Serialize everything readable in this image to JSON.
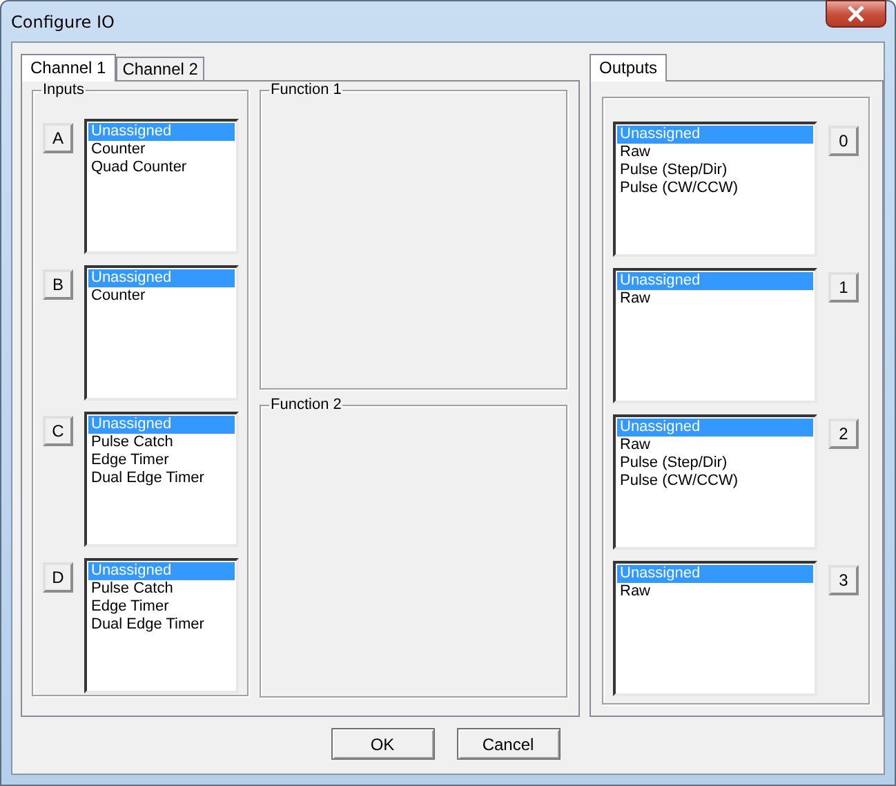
{
  "window": {
    "title": "Configure IO"
  },
  "channel_tabs": [
    {
      "label": "Channel 1",
      "selected": true
    },
    {
      "label": "Channel 2",
      "selected": false
    }
  ],
  "inputs": {
    "label": "Inputs",
    "rows": [
      {
        "button": "A",
        "items": [
          {
            "label": "Unassigned",
            "selected": true
          },
          {
            "label": "Counter",
            "selected": false
          },
          {
            "label": "Quad Counter",
            "selected": false
          }
        ]
      },
      {
        "button": "B",
        "items": [
          {
            "label": "Unassigned",
            "selected": true
          },
          {
            "label": "Counter",
            "selected": false
          }
        ]
      },
      {
        "button": "C",
        "items": [
          {
            "label": "Unassigned",
            "selected": true
          },
          {
            "label": "Pulse Catch",
            "selected": false
          },
          {
            "label": "Edge Timer",
            "selected": false
          },
          {
            "label": "Dual Edge Timer",
            "selected": false
          }
        ]
      },
      {
        "button": "D",
        "items": [
          {
            "label": "Unassigned",
            "selected": true
          },
          {
            "label": "Pulse Catch",
            "selected": false
          },
          {
            "label": "Edge Timer",
            "selected": false
          },
          {
            "label": "Dual Edge Timer",
            "selected": false
          }
        ]
      }
    ]
  },
  "functions": [
    {
      "label": "Function 1"
    },
    {
      "label": "Function 2"
    }
  ],
  "output_tabs": [
    {
      "label": "Outputs",
      "selected": true
    }
  ],
  "outputs": {
    "rows": [
      {
        "button": "0",
        "items": [
          {
            "label": "Unassigned",
            "selected": true
          },
          {
            "label": "Raw",
            "selected": false
          },
          {
            "label": "Pulse (Step/Dir)",
            "selected": false
          },
          {
            "label": "Pulse (CW/CCW)",
            "selected": false
          }
        ]
      },
      {
        "button": "1",
        "items": [
          {
            "label": "Unassigned",
            "selected": true
          },
          {
            "label": "Raw",
            "selected": false
          }
        ]
      },
      {
        "button": "2",
        "items": [
          {
            "label": "Unassigned",
            "selected": true
          },
          {
            "label": "Raw",
            "selected": false
          },
          {
            "label": "Pulse (Step/Dir)",
            "selected": false
          },
          {
            "label": "Pulse (CW/CCW)",
            "selected": false
          }
        ]
      },
      {
        "button": "3",
        "items": [
          {
            "label": "Unassigned",
            "selected": true
          },
          {
            "label": "Raw",
            "selected": false
          }
        ]
      }
    ]
  },
  "buttons": [
    {
      "label": "OK"
    },
    {
      "label": "Cancel"
    }
  ]
}
